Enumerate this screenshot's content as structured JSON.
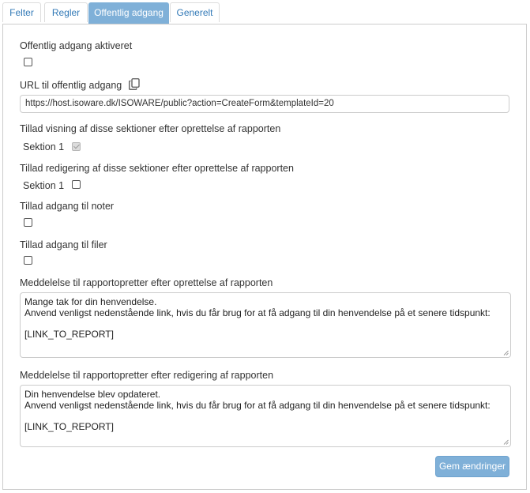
{
  "tabs": [
    {
      "label": "Felter",
      "active": false
    },
    {
      "label": "Regler",
      "active": false
    },
    {
      "label": "Offentlig adgang",
      "active": true
    },
    {
      "label": "Generelt",
      "active": false
    }
  ],
  "public_access": {
    "enabled_label": "Offentlig adgang aktiveret",
    "enabled": false
  },
  "url": {
    "label": "URL til offentlig adgang",
    "copy_icon": "copy-icon",
    "value": "https://host.isoware.dk/ISOWARE/public?action=CreateForm&templateId=20"
  },
  "view_sections": {
    "label": "Tillad visning af disse sektioner efter oprettelse af rapporten",
    "section_label": "Sektion 1",
    "checked": true,
    "disabled": true
  },
  "edit_sections": {
    "label": "Tillad redigering af disse sektioner efter oprettelse af rapporten",
    "section_label": "Sektion 1",
    "checked": false
  },
  "notes_access": {
    "label": "Tillad adgang til noter",
    "checked": false
  },
  "files_access": {
    "label": "Tillad adgang til filer",
    "checked": false
  },
  "create_message": {
    "label": "Meddelelse til rapportopretter efter oprettelse af rapporten",
    "lines": [
      "Mange tak for din henvendelse.",
      "Anvend venligst nedenstående link, hvis du får brug for at få adgang til din henvendelse på et senere tidspunkt:",
      "",
      "[LINK_TO_REPORT]"
    ]
  },
  "edit_message": {
    "label": "Meddelelse til rapportopretter efter redigering af rapporten",
    "lines": [
      "Din henvendelse blev opdateret.",
      "Anvend venligst nedenstående link, hvis du får brug for at få adgang til din henvendelse på et senere tidspunkt:",
      "",
      "[LINK_TO_REPORT]"
    ]
  },
  "save_button": {
    "label": "Gem ændringer"
  },
  "colors": {
    "accent": "#7fb0d8",
    "link": "#337ab7",
    "text": "#333333",
    "border": "#cccccc"
  }
}
